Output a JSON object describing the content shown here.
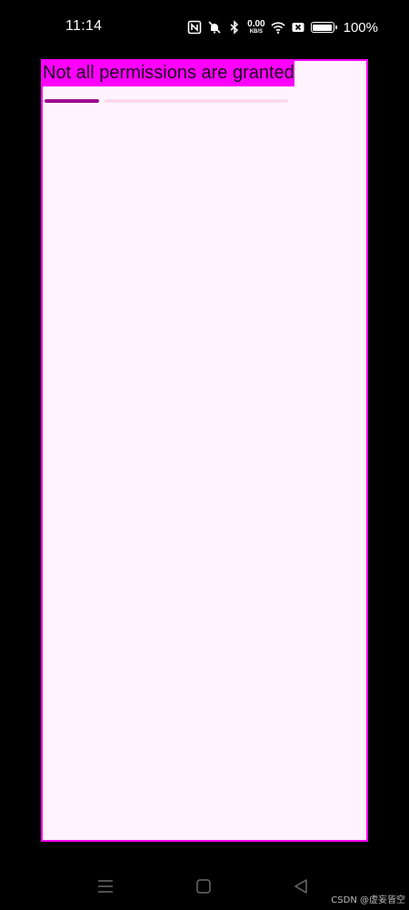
{
  "status_bar": {
    "time": "11:14",
    "net_speed_value": "0.00",
    "net_speed_unit": "KB/S",
    "battery_percent": "100%",
    "battery_level": 1.0,
    "icons": [
      "nfc-icon",
      "mute-icon",
      "bluetooth-icon",
      "net-speed",
      "wifi-icon",
      "no-sim-icon",
      "battery-icon"
    ]
  },
  "app": {
    "message": "Not all permissions are granted",
    "progress": {
      "indeterminate": true
    },
    "colors": {
      "border": "#ff00ff",
      "message_background": "#ff00ff",
      "panel_background": "#fff4fd",
      "progress_indicator": "#9b0093",
      "progress_track": "#fbd8ef"
    }
  },
  "nav_bar": {
    "buttons": [
      "menu-icon",
      "home-icon",
      "back-icon"
    ]
  },
  "watermark": "CSDN @虚妄皆空"
}
